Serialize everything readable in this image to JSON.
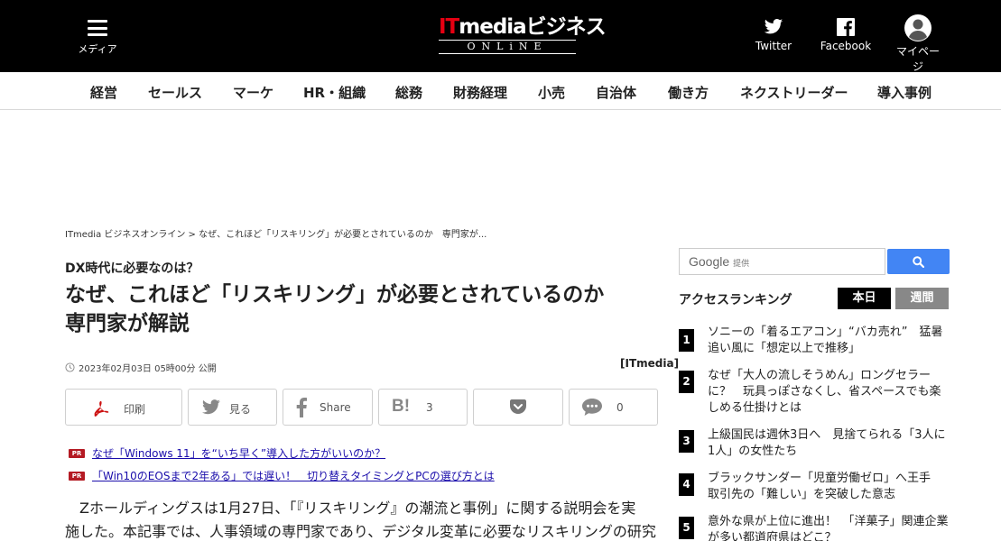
{
  "header": {
    "menu_label": "メディア",
    "logo_top_it": "IT",
    "logo_top_rest": "mediaビジネス",
    "logo_bottom": "ONLiNE",
    "twitter_label": "Twitter",
    "facebook_label": "Facebook",
    "mypage_label": "マイページ"
  },
  "categories": [
    "経営",
    "セールス",
    "マーケ",
    "HR・組織",
    "総務",
    "財務経理",
    "小売",
    "自治体",
    "働き方",
    "ネクストリーダー",
    "導入事例"
  ],
  "breadcrumb": "ITmedia ビジネスオンライン > なぜ、これほど「リスキリング」が必要とされているのか　専門家が...",
  "article": {
    "kicker": "DX時代に必要なのは？",
    "title_line1": "なぜ、これほど「リスキリング」が必要とされているのか",
    "title_line2": "専門家が解説",
    "date": "2023年02月03日 05時00分 公開",
    "byline": "[ITmedia]",
    "share": {
      "print": "印刷",
      "twitter": "見る",
      "facebook": "Share",
      "hatena_count": "3",
      "comment_count": "0"
    },
    "pr_badge": "PR",
    "pr_links": [
      "なぜ「Windows 11」を“いち早く”導入した方がいいのか？",
      "「Win10のEOSまで2年ある」では遅い！　切り替えタイミングとPCの選び方とは"
    ],
    "body_line1": "Zホールディングスは1月27日、「『リスキリング』の潮流と事例」に関する説明会を実",
    "body_line2": "施した。本記事では、人事領域の専門家であり、デジタル変革に必要なリスキリングの研究"
  },
  "sidebar": {
    "search_brand": "Google",
    "search_provided": "提供",
    "ranking_title": "アクセスランキング",
    "tab_today": "本日",
    "tab_week": "週間",
    "ranking": [
      {
        "num": "1",
        "text": "ソニーの「着るエアコン」“バカ売れ”　猛暑追い風に「想定以上で推移」"
      },
      {
        "num": "2",
        "text": "なぜ「大人の流しそうめん」ロングセラーに？　玩具っぽさなくし、省スペースでも楽しめる仕掛けとは"
      },
      {
        "num": "3",
        "text": "上級国民は週休3日へ　見捨てられる「3人に1人」の女性たち"
      },
      {
        "num": "4",
        "text": "ブラックサンダー「児童労働ゼロ」へ王手　取引先の「難しい」を突破した意志"
      },
      {
        "num": "5",
        "text": "意外な県が上位に進出！　「洋菓子」関連企業が多い都道府県はどこ？"
      }
    ]
  },
  "colors": {
    "header_bg": "#000000",
    "accent_red": "#e60012",
    "search_blue": "#4285f4",
    "pr_red": "#b41a23"
  }
}
